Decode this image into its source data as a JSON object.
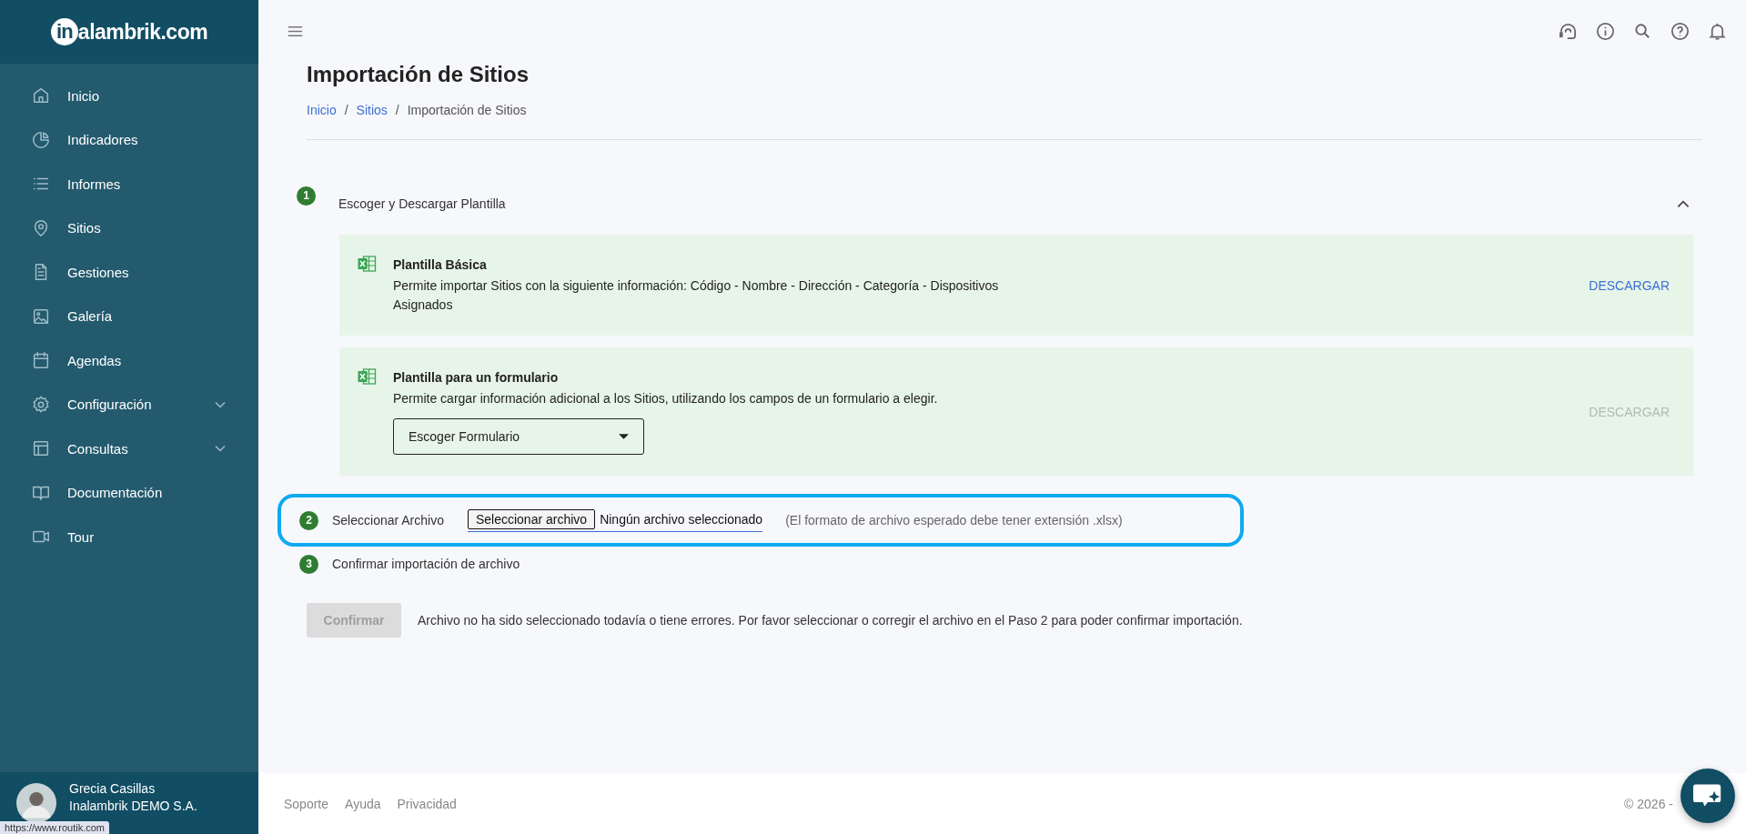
{
  "logo": {
    "mark": "in",
    "text": "alambrik.com"
  },
  "sidebar": {
    "items": [
      {
        "label": "Inicio",
        "has_submenu": false
      },
      {
        "label": "Indicadores",
        "has_submenu": false
      },
      {
        "label": "Informes",
        "has_submenu": false
      },
      {
        "label": "Sitios",
        "has_submenu": false
      },
      {
        "label": "Gestiones",
        "has_submenu": false
      },
      {
        "label": "Galería",
        "has_submenu": false
      },
      {
        "label": "Agendas",
        "has_submenu": false
      },
      {
        "label": "Configuración",
        "has_submenu": true
      },
      {
        "label": "Consultas",
        "has_submenu": true
      },
      {
        "label": "Documentación",
        "has_submenu": false
      },
      {
        "label": "Tour",
        "has_submenu": false
      }
    ]
  },
  "user": {
    "name": "Grecia Casillas",
    "company": "Inalambrik DEMO S.A."
  },
  "status_url": "https://www.routik.com",
  "page": {
    "title": "Importación de Sitios",
    "breadcrumb": [
      {
        "label": "Inicio",
        "link": true
      },
      {
        "label": "Sitios",
        "link": true
      },
      {
        "label": "Importación de Sitios",
        "link": false
      }
    ],
    "separator": "/"
  },
  "step1": {
    "number": "1",
    "label": "Escoger y Descargar Plantilla",
    "expanded": true,
    "templates": [
      {
        "title": "Plantilla Básica",
        "description": "Permite importar Sitios con la siguiente información: Código - Nombre - Dirección - Categoría - Dispositivos Asignados",
        "download": "DESCARGAR",
        "disabled": false
      },
      {
        "title": "Plantilla para un formulario",
        "description": "Permite cargar información adicional a los Sitios, utilizando los campos de un formulario a elegir.",
        "select": "Escoger Formulario",
        "download": "DESCARGAR",
        "disabled": true
      }
    ]
  },
  "step2": {
    "number": "2",
    "label": "Seleccionar Archivo",
    "highlighted": true,
    "file_button": "Seleccionar archivo",
    "file_status": "Ningún archivo seleccionado",
    "hint": "(El formato de archivo esperado debe tener extensión .xlsx)"
  },
  "step3": {
    "number": "3",
    "label": "Confirmar importación de archivo",
    "button": "Confirmar",
    "disabled": true,
    "message": "Archivo no ha sido seleccionado todavía o tiene errores. Por favor seleccionar o corregir el archivo en el Paso 2 para poder confirmar importación."
  },
  "footer": {
    "links": [
      "Soporte",
      "Ayuda",
      "Privacidad"
    ],
    "copyright": "© 2026 -"
  }
}
